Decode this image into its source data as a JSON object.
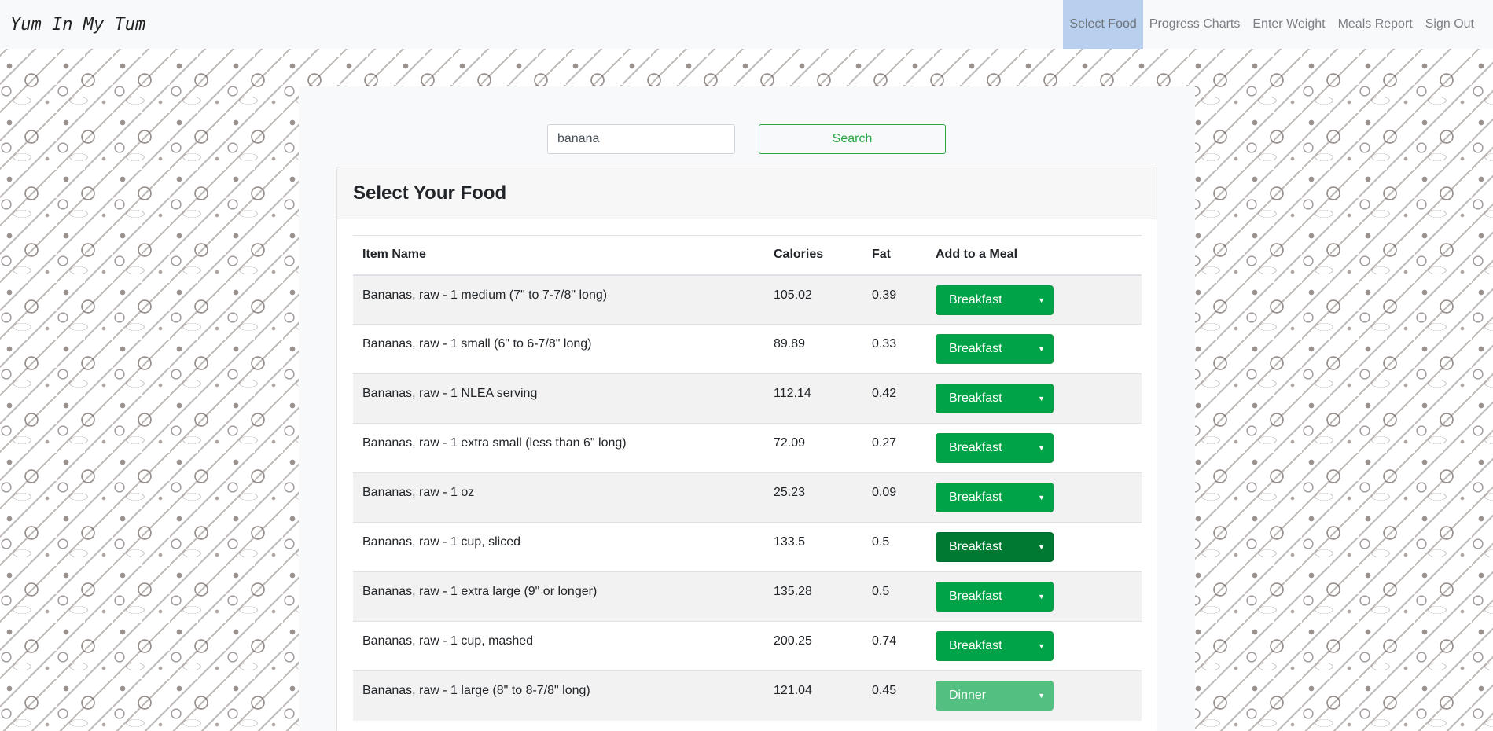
{
  "nav": {
    "brand": "Yum In My Tum",
    "links": [
      {
        "label": "Select Food"
      },
      {
        "label": "Progress Charts"
      },
      {
        "label": "Enter Weight"
      },
      {
        "label": "Meals Report"
      },
      {
        "label": "Sign Out"
      }
    ],
    "active_link": "Select Food"
  },
  "search": {
    "value": "banana",
    "button_label": "Search"
  },
  "card": {
    "title": "Select Your Food"
  },
  "table": {
    "headers": [
      "Item Name",
      "Calories",
      "Fat",
      "Add to a Meal"
    ],
    "rows": [
      {
        "name": "Bananas, raw - 1 medium (7\" to 7-7/8\" long)",
        "calories": "105.02",
        "fat": "0.39",
        "meal": "Breakfast"
      },
      {
        "name": "Bananas, raw - 1 small (6\" to 6-7/8\" long)",
        "calories": "89.89",
        "fat": "0.33",
        "meal": "Breakfast"
      },
      {
        "name": "Bananas, raw - 1 NLEA serving",
        "calories": "112.14",
        "fat": "0.42",
        "meal": "Breakfast"
      },
      {
        "name": "Bananas, raw - 1 extra small (less than 6\" long)",
        "calories": "72.09",
        "fat": "0.27",
        "meal": "Breakfast"
      },
      {
        "name": "Bananas, raw - 1 oz",
        "calories": "25.23",
        "fat": "0.09",
        "meal": "Breakfast"
      },
      {
        "name": "Bananas, raw - 1 cup, sliced",
        "calories": "133.5",
        "fat": "0.5",
        "meal": "Breakfast"
      },
      {
        "name": "Bananas, raw - 1 extra large (9\" or longer)",
        "calories": "135.28",
        "fat": "0.5",
        "meal": "Breakfast"
      },
      {
        "name": "Bananas, raw - 1 cup, mashed",
        "calories": "200.25",
        "fat": "0.74",
        "meal": "Breakfast"
      },
      {
        "name": "Bananas, raw - 1 large (8\" to 8-7/8\" long)",
        "calories": "121.04",
        "fat": "0.45",
        "meal": "Dinner"
      }
    ]
  },
  "colors": {
    "accent_green": "#28a745",
    "select_green": "#00a347",
    "select_green_hover": "#007a33",
    "select_green_light": "#53c082",
    "nav_active_bg": "#b8cfee"
  },
  "icons": {
    "dropdown_caret": "caret-down-icon"
  }
}
